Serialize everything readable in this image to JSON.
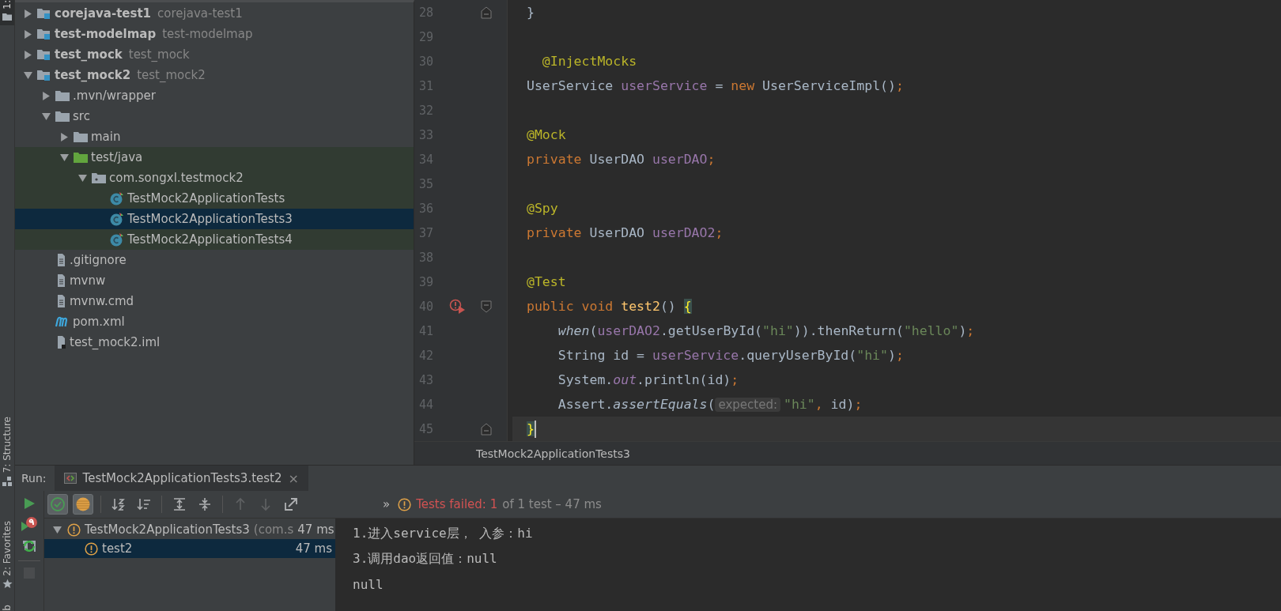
{
  "side_strip": {
    "top_label": "1:",
    "structure_label": "7: Structure",
    "favorites_label": "2: Favorites",
    "bottom_label": "b"
  },
  "project_tree": [
    {
      "label": "corejava-test1",
      "module_name": "corejava-test1",
      "kind": "module",
      "expanded": false,
      "selected": false
    },
    {
      "label": "test-modelmap",
      "module_name": "test-modelmap",
      "kind": "module",
      "expanded": false,
      "selected": false
    },
    {
      "label": "test_mock",
      "module_name": "test_mock",
      "kind": "module",
      "expanded": false,
      "selected": false
    },
    {
      "label": "test_mock2",
      "module_name": "test_mock2",
      "kind": "module",
      "expanded": true,
      "selected": false,
      "children": [
        {
          "label": ".mvn/wrapper",
          "kind": "folder",
          "expanded": false,
          "selected": false
        },
        {
          "label": "src",
          "kind": "folder",
          "expanded": true,
          "selected": false,
          "children": [
            {
              "label": "main",
              "kind": "folder",
              "expanded": false,
              "selected": false
            },
            {
              "label": "test/java",
              "kind": "test-folder",
              "expanded": true,
              "selected": false,
              "test_source": true,
              "children": [
                {
                  "label": "com.songxl.testmock2",
                  "kind": "package",
                  "expanded": true,
                  "selected": false,
                  "test_source": true,
                  "children": [
                    {
                      "label": "TestMock2ApplicationTests",
                      "kind": "test-class",
                      "selected": false,
                      "test_source": true
                    },
                    {
                      "label": "TestMock2ApplicationTests3",
                      "kind": "test-class",
                      "selected": true,
                      "test_source": true
                    },
                    {
                      "label": "TestMock2ApplicationTests4",
                      "kind": "test-class",
                      "selected": false,
                      "test_source": true
                    }
                  ]
                }
              ]
            }
          ]
        },
        {
          "label": ".gitignore",
          "kind": "file",
          "selected": false
        },
        {
          "label": "mvnw",
          "kind": "file",
          "selected": false
        },
        {
          "label": "mvnw.cmd",
          "kind": "file",
          "selected": false
        },
        {
          "label": "pom.xml",
          "kind": "maven",
          "selected": false
        },
        {
          "label": "test_mock2.iml",
          "kind": "iml",
          "selected": false
        }
      ]
    }
  ],
  "editor": {
    "lines": [
      {
        "number": "28",
        "kind": "block-end",
        "tokens": [
          {
            "kind": "plain",
            "text": "}"
          }
        ]
      },
      {
        "number": "29",
        "kind": "code"
      },
      {
        "number": "30",
        "kind": "code",
        "tokens": [
          {
            "kind": "annotation",
            "text": "  @InjectMocks"
          }
        ]
      },
      {
        "number": "31",
        "kind": "code",
        "tokens": [
          {
            "kind": "plain",
            "text": "UserService "
          },
          {
            "kind": "field",
            "text": "userService"
          },
          {
            "kind": "plain",
            "text": " = "
          },
          {
            "kind": "keyword",
            "text": "new"
          },
          {
            "kind": "plain",
            "text": " UserServiceImpl()"
          },
          {
            "kind": "keyword",
            "text": ";"
          }
        ]
      },
      {
        "number": "32",
        "kind": "code"
      },
      {
        "number": "33",
        "kind": "code",
        "tokens": [
          {
            "kind": "annotation",
            "text": "@Mock"
          }
        ]
      },
      {
        "number": "34",
        "kind": "code",
        "tokens": [
          {
            "kind": "keyword",
            "text": "private"
          },
          {
            "kind": "plain",
            "text": " UserDAO "
          },
          {
            "kind": "field",
            "text": "userDAO"
          },
          {
            "kind": "keyword",
            "text": ";"
          }
        ]
      },
      {
        "number": "35",
        "kind": "code"
      },
      {
        "number": "36",
        "kind": "code",
        "tokens": [
          {
            "kind": "annotation",
            "text": "@Spy"
          }
        ]
      },
      {
        "number": "37",
        "kind": "code",
        "tokens": [
          {
            "kind": "keyword",
            "text": "private"
          },
          {
            "kind": "plain",
            "text": " UserDAO "
          },
          {
            "kind": "field",
            "text": "userDAO2"
          },
          {
            "kind": "keyword",
            "text": ";"
          }
        ]
      },
      {
        "number": "38",
        "kind": "code"
      },
      {
        "number": "39",
        "kind": "code",
        "tokens": [
          {
            "kind": "annotation",
            "text": "@Test"
          }
        ]
      },
      {
        "number": "40",
        "kind": "failed-test",
        "tokens": [
          {
            "kind": "keyword",
            "text": "public void "
          },
          {
            "kind": "method",
            "text": "test2"
          },
          {
            "kind": "plain",
            "text": "() "
          },
          {
            "kind": "brace",
            "text": "{"
          }
        ]
      },
      {
        "number": "41",
        "kind": "code",
        "tokens": [
          {
            "kind": "static-call",
            "text": "    when"
          },
          {
            "kind": "plain",
            "text": "("
          },
          {
            "kind": "field",
            "text": "userDAO2"
          },
          {
            "kind": "plain",
            "text": ".getUserById("
          },
          {
            "kind": "string",
            "text": "\"hi\""
          },
          {
            "kind": "plain",
            "text": ")).thenReturn("
          },
          {
            "kind": "string",
            "text": "\"hello\""
          },
          {
            "kind": "plain",
            "text": ")"
          },
          {
            "kind": "keyword",
            "text": ";"
          }
        ]
      },
      {
        "number": "42",
        "kind": "code",
        "tokens": [
          {
            "kind": "plain",
            "text": "    String id = "
          },
          {
            "kind": "field",
            "text": "userService"
          },
          {
            "kind": "plain",
            "text": ".queryUserById("
          },
          {
            "kind": "string",
            "text": "\"hi\""
          },
          {
            "kind": "plain",
            "text": ")"
          },
          {
            "kind": "keyword",
            "text": ";"
          }
        ]
      },
      {
        "number": "43",
        "kind": "code",
        "tokens": [
          {
            "kind": "plain",
            "text": "    System."
          },
          {
            "kind": "static-field",
            "text": "out"
          },
          {
            "kind": "plain",
            "text": ".println(id)"
          },
          {
            "kind": "keyword",
            "text": ";"
          }
        ]
      },
      {
        "number": "44",
        "kind": "code",
        "tokens": [
          {
            "kind": "plain",
            "text": "    Assert."
          },
          {
            "kind": "static-call",
            "text": "assertEquals"
          },
          {
            "kind": "plain",
            "text": "("
          },
          {
            "kind": "hint",
            "text": "expected:"
          },
          {
            "kind": "string",
            "text": "\"hi\""
          },
          {
            "kind": "keyword",
            "text": ","
          },
          {
            "kind": "plain",
            "text": " id)"
          },
          {
            "kind": "keyword",
            "text": ";"
          }
        ]
      },
      {
        "number": "45",
        "kind": "block-end",
        "current": true,
        "tokens": [
          {
            "kind": "brace",
            "text": "}"
          }
        ]
      }
    ],
    "breadcrumb": "TestMock2ApplicationTests3"
  },
  "run": {
    "label": "Run:",
    "tab": {
      "title": "TestMock2ApplicationTests3.test2",
      "close": "×"
    },
    "side_buttons": [
      {
        "kind": "rerun",
        "disabled": false
      },
      {
        "kind": "rerun-failed",
        "disabled": false
      },
      {
        "kind": "auto-test",
        "disabled": false
      },
      {
        "kind": "stop",
        "disabled": true
      }
    ],
    "toolbar": [
      {
        "kind": "show-passed",
        "on": true,
        "disabled": false
      },
      {
        "kind": "show-ignored",
        "on": true,
        "disabled": false
      },
      {
        "kind": "sort-alpha",
        "on": false,
        "disabled": false
      },
      {
        "kind": "sort-duration",
        "on": false,
        "disabled": false
      },
      {
        "kind": "expand-all",
        "on": false,
        "disabled": false
      },
      {
        "kind": "collapse-all",
        "on": false,
        "disabled": false
      },
      {
        "kind": "previous",
        "on": false,
        "disabled": true
      },
      {
        "kind": "next",
        "on": false,
        "disabled": true
      },
      {
        "kind": "export",
        "on": false,
        "disabled": false
      }
    ],
    "more": "»",
    "status": {
      "failed": "Tests failed: 1",
      "rest": "of 1 test – 47 ms"
    },
    "tests": [
      {
        "label": "TestMock2ApplicationTests3",
        "detail": "(com.s",
        "time": "47 ms",
        "kind": "failed",
        "expanded": true,
        "selected": false,
        "children": [
          {
            "label": "test2",
            "time": "47 ms",
            "kind": "failed",
            "selected": true
          }
        ]
      }
    ],
    "console": [
      "1.进入service层， 入参：hi",
      "3.调用dao返回值：null",
      "null"
    ]
  }
}
